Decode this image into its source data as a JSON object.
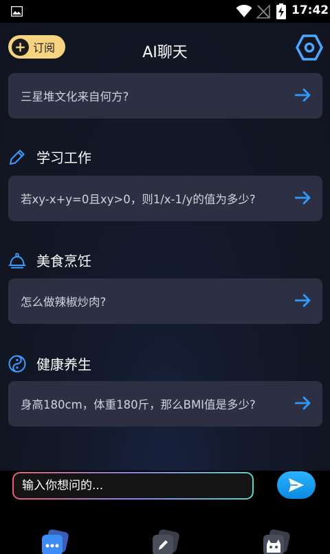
{
  "status_bar": {
    "time": "17:42",
    "icons": [
      "gallery-icon",
      "wifi-icon",
      "signal-off-icon",
      "battery-charging-icon"
    ]
  },
  "header": {
    "subscribe_label": "订阅",
    "title": "AI聊天",
    "settings_icon": "hexagon-gear-icon"
  },
  "content": {
    "first_prompt": "三星堆文化来自何方?",
    "sections": [
      {
        "title": "学习工作",
        "icon": "pencil-icon",
        "prompt": "若xy-x+y=0且xy>0，则1/x-1/y的值为多少?"
      },
      {
        "title": "美食烹饪",
        "icon": "cloche-icon",
        "prompt": "怎么做辣椒炒肉?"
      },
      {
        "title": "健康养生",
        "icon": "yin-yang-icon",
        "prompt": "身高180cm，体重180斤，那么BMI值是多少?"
      }
    ]
  },
  "input": {
    "placeholder": "输入你想问的..."
  },
  "colors": {
    "accent_blue": "#2f9bff",
    "subscribe_yellow": "#f6d37f",
    "card_bg": "#2c3042"
  },
  "bottom_nav": {
    "icons": [
      "chat-icon",
      "write-icon",
      "robot-icon"
    ]
  }
}
